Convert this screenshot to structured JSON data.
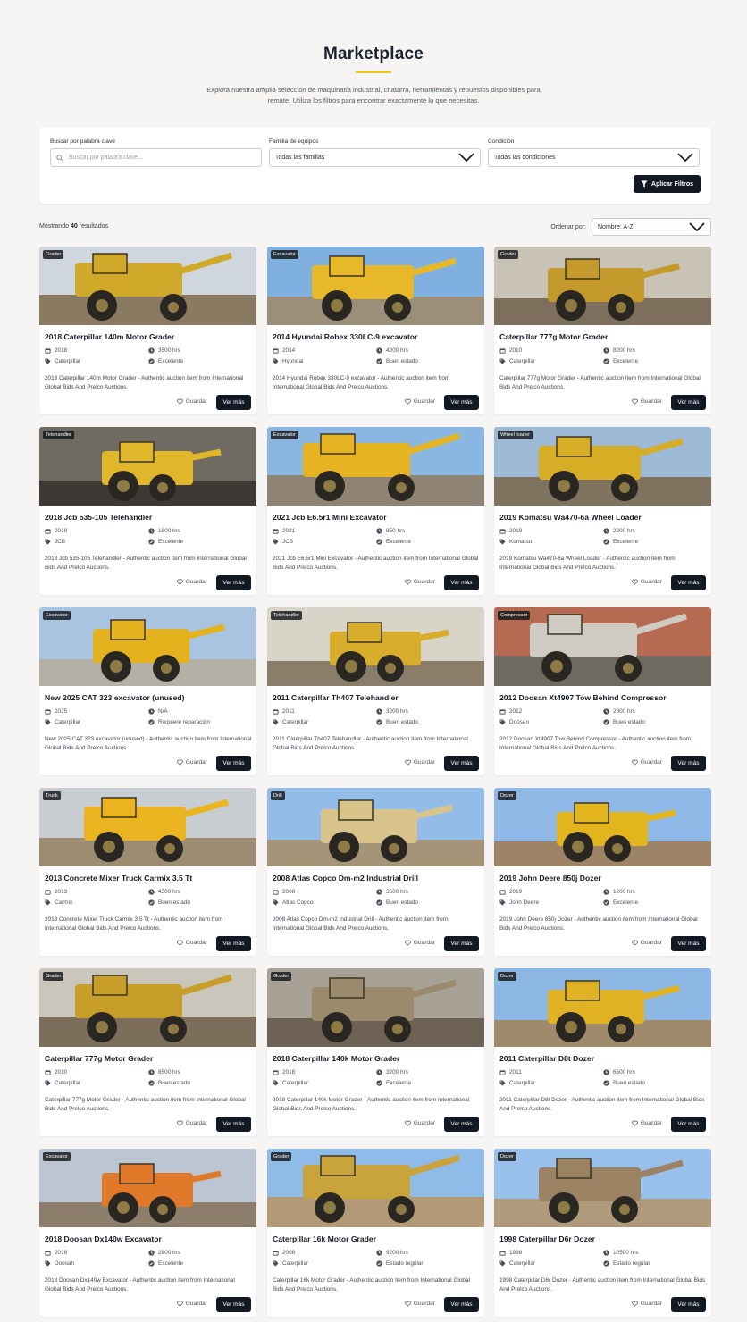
{
  "header": {
    "title": "Marketplace",
    "subtitle": "Explora nuestra amplia selección de maquinaria industrial, chatarra, herramientas y repuestos disponibles para remate. Utiliza los filtros para encontrar exactamente lo que necesitas."
  },
  "filters": {
    "search_label": "Buscar por palabra clave",
    "search_placeholder": "Buscar por palabra clave...",
    "family_label": "Familia de equipos",
    "family_value": "Todas las familias",
    "condition_label": "Condición",
    "condition_value": "Todas las condiciones",
    "apply_label": "Aplicar Filtros"
  },
  "results": {
    "prefix": "Mostrando",
    "count": "40",
    "suffix": "resultados",
    "sort_label": "Ordenar por:",
    "sort_value": "Nombre: A-Z"
  },
  "card_actions": {
    "save_label": "Guardar",
    "more_label": "Ver más"
  },
  "colors": {
    "accent": "#f0c419",
    "button_dark": "#131924"
  },
  "listings": [
    {
      "badge": "Grader",
      "title": "2018 Caterpillar 140m Motor Grader",
      "year": "2018",
      "hours": "3500 hrs",
      "brand": "Caterpillar",
      "condition": "Excelente",
      "description": "2018 Caterpillar 140m Motor Grader - Authentic auction item from International Global Bids And Prelco Auctions.",
      "sky": "#cfd6dd",
      "machine": "#d1a92a",
      "ground": "#8a7a62"
    },
    {
      "badge": "Excavator",
      "title": "2014 Hyundai Robex 330LC-9 excavator",
      "year": "2014",
      "hours": "4200 hrs",
      "brand": "Hyundai",
      "condition": "Buen estado",
      "description": "2014 Hyundai Robex 330LC-9 excavator - Authentic auction item from International Global Bids And Prelco Auctions.",
      "sky": "#7fb0e0",
      "machine": "#e7b92a",
      "ground": "#9c8f7a"
    },
    {
      "badge": "Grader",
      "title": "Caterpillar 777g Motor Grader",
      "year": "2010",
      "hours": "8200 hrs",
      "brand": "Caterpillar",
      "condition": "Excelente",
      "description": "Caterpillar 777g Motor Grader - Authentic auction item from International Global Bids And Prelco Auctions.",
      "sky": "#c9c3b6",
      "machine": "#c49a2c",
      "ground": "#7d6f5c"
    },
    {
      "badge": "Telehandler",
      "title": "2018 Jcb 535-105 Telehandler",
      "year": "2018",
      "hours": "1800 hrs",
      "brand": "JCB",
      "condition": "Excelente",
      "description": "2018 Jcb 535-105 Telehandler - Authentic auction item from International Global Bids And Prelco Auctions.",
      "sky": "#6f6a62",
      "machine": "#e0b72a",
      "ground": "#3d3a35"
    },
    {
      "badge": "Excavator",
      "title": "2021 Jcb E6.5r1 Mini Excavator",
      "year": "2021",
      "hours": "850 hrs",
      "brand": "JCB",
      "condition": "Excelente",
      "description": "2021 Jcb E6.5r1 Mini Excavator - Authentic auction item from International Global Bids And Prelco Auctions.",
      "sky": "#8ab6e2",
      "machine": "#e6b322",
      "ground": "#8f8373"
    },
    {
      "badge": "Wheel loader",
      "title": "2019 Komatsu Wa470-6a Wheel Loader",
      "year": "2019",
      "hours": "2200 hrs",
      "brand": "Komatsu",
      "condition": "Excelente",
      "description": "2019 Komatsu Wa470-6a Wheel Loader - Authentic auction item from International Global Bids And Prelco Auctions.",
      "sky": "#9cb9d6",
      "machine": "#d8ad26",
      "ground": "#7f735f"
    },
    {
      "badge": "Excavator",
      "title": "New 2025 CAT 323 excavator (unused)",
      "year": "2025",
      "hours": "N/A",
      "brand": "Caterpillar",
      "condition": "Requiere reparación",
      "description": "New 2025 CAT 323 excavator (unused) - Authentic auction item from International Global Bids And Prelco Auctions.",
      "sky": "#a9c4e0",
      "machine": "#e4b21c",
      "ground": "#b5b0a6"
    },
    {
      "badge": "Telehandler",
      "title": "2011 Caterpillar Th407 Telehandler",
      "year": "2011",
      "hours": "3200 hrs",
      "brand": "Caterpillar",
      "condition": "Buen estado",
      "description": "2011 Caterpillar Th407 Telehandler - Authentic auction item from International Global Bids And Prelco Auctions.",
      "sky": "#d9d4c8",
      "machine": "#d9ad2c",
      "ground": "#8a7e6a"
    },
    {
      "badge": "Compressor",
      "title": "2012 Doosan Xt4907 Tow Behind Compressor",
      "year": "2012",
      "hours": "2800 hrs",
      "brand": "Doosan",
      "condition": "Buen estado",
      "description": "2012 Doosan Xt4907 Tow Behind Compressor - Authentic auction item from International Global Bids And Prelco Auctions.",
      "sky": "#b66a52",
      "machine": "#cfcbc2",
      "ground": "#6f6a60"
    },
    {
      "badge": "Truck",
      "title": "2013 Concrete Mixer Truck Carmix 3.5 Tt",
      "year": "2013",
      "hours": "4500 hrs",
      "brand": "Carmix",
      "condition": "Buen estado",
      "description": "2013 Concrete Mixer Truck Carmix 3.5 Tt - Authentic auction item from International Global Bids And Prelco Auctions.",
      "sky": "#c8cdd2",
      "machine": "#eab521",
      "ground": "#9b8c72"
    },
    {
      "badge": "Drill",
      "title": "2008 Atlas Copco Dm-m2 Industrial Drill",
      "year": "2008",
      "hours": "3500 hrs",
      "brand": "Atlas Copco",
      "condition": "Buen estado",
      "description": "2008 Atlas Copco Dm-m2 Industrial Drill - Authentic auction item from International Global Bids And Prelco Auctions.",
      "sky": "#93bde8",
      "machine": "#d8c48a",
      "ground": "#a49478"
    },
    {
      "badge": "Dozer",
      "title": "2019 John Deere 850j Dozer",
      "year": "2019",
      "hours": "1200 hrs",
      "brand": "John Deere",
      "condition": "Excelente",
      "description": "2019 John Deere 850j Dozer - Authentic auction item from International Global Bids And Prelco Auctions.",
      "sky": "#8fb8e6",
      "machine": "#e2b51f",
      "ground": "#9e8466"
    },
    {
      "badge": "Grader",
      "title": "Caterpillar 777g Motor Grader",
      "year": "2010",
      "hours": "8500 hrs",
      "brand": "Caterpillar",
      "condition": "Buen estado",
      "description": "Caterpillar 777g Motor Grader - Authentic auction item from International Global Bids And Prelco Auctions.",
      "sky": "#cbc6bb",
      "machine": "#c89e2a",
      "ground": "#7c6e5a"
    },
    {
      "badge": "Grader",
      "title": "2018 Caterpillar 140k Motor Grader",
      "year": "2018",
      "hours": "3200 hrs",
      "brand": "Caterpillar",
      "condition": "Excelente",
      "description": "2018 Caterpillar 140k Motor Grader - Authentic auction item from International Global Bids And Prelco Auctions.",
      "sky": "#a8a296",
      "machine": "#9b8a6c",
      "ground": "#6d6253"
    },
    {
      "badge": "Dozer",
      "title": "2011 Caterpillar D8t Dozer",
      "year": "2011",
      "hours": "6500 hrs",
      "brand": "Caterpillar",
      "condition": "Buen estado",
      "description": "2011 Caterpillar D8t Dozer - Authentic auction item from International Global Bids And Prelco Auctions.",
      "sky": "#8cb7e4",
      "machine": "#e0b224",
      "ground": "#a08a6c"
    },
    {
      "badge": "Excavator",
      "title": "2018 Doosan Dx140w Excavator",
      "year": "2018",
      "hours": "2800 hrs",
      "brand": "Doosan",
      "condition": "Excelente",
      "description": "2018 Doosan Dx140w Excavator - Authentic auction item from International Global Bids And Prelco Auctions.",
      "sky": "#bcc6d2",
      "machine": "#e07a2a",
      "ground": "#8c7e6a"
    },
    {
      "badge": "Grader",
      "title": "Caterpillar 16k Motor Grader",
      "year": "2008",
      "hours": "9200 hrs",
      "brand": "Caterpillar",
      "condition": "Estado regular",
      "description": "Caterpillar 16k Motor Grader - Authentic auction item from International Global Bids And Prelco Auctions.",
      "sky": "#8fbbe8",
      "machine": "#c9a43a",
      "ground": "#b39a76"
    },
    {
      "badge": "Dozer",
      "title": "1998 Caterpillar D6r Dozer",
      "year": "1998",
      "hours": "10500 hrs",
      "brand": "Caterpillar",
      "condition": "Estado regular",
      "description": "1998 Caterpillar D6r Dozer - Authentic auction item from International Global Bids And Prelco Auctions.",
      "sky": "#98c0ea",
      "machine": "#9b8262",
      "ground": "#b09a7c"
    }
  ]
}
